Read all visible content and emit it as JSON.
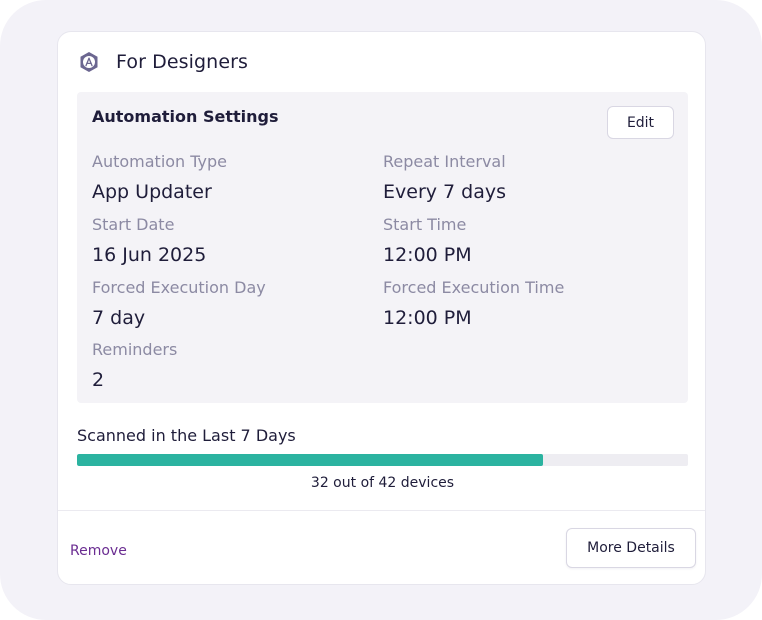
{
  "card": {
    "title": "For Designers",
    "icon": "designer-badge-icon"
  },
  "settings": {
    "title": "Automation Settings",
    "edit_label": "Edit",
    "fields": [
      {
        "label": "Automation Type",
        "value": "App Updater"
      },
      {
        "label": "Repeat Interval",
        "value": "Every 7 days"
      },
      {
        "label": "Start Date",
        "value": "16 Jun 2025"
      },
      {
        "label": "Start Time",
        "value": "12:00 PM"
      },
      {
        "label": "Forced Execution Day",
        "value": "7 day"
      },
      {
        "label": "Forced Execution Time",
        "value": "12:00 PM"
      },
      {
        "label": "Reminders",
        "value": "2"
      }
    ]
  },
  "scan": {
    "title": "Scanned in the Last 7 Days",
    "scanned": 32,
    "total": 42,
    "caption": "32 out of 42 devices"
  },
  "footer": {
    "remove_label": "Remove",
    "more_details_label": "More Details"
  },
  "colors": {
    "accent": "#2bb3a0",
    "link": "#6a2c91",
    "text": "#1f1d3a",
    "muted": "#8c8aa3"
  }
}
